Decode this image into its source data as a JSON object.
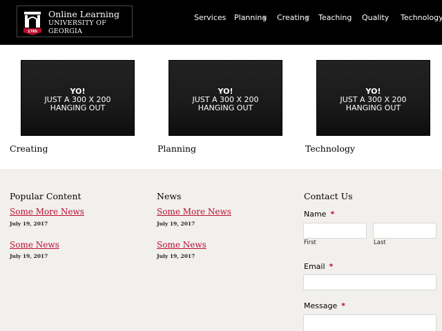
{
  "header": {
    "brand_title": "Online Learning",
    "brand_subtitle": "UNIVERSITY OF GEORGIA",
    "seal_year": "1785",
    "nav": [
      {
        "label": "Services",
        "has_dropdown": false
      },
      {
        "label": "Planning",
        "has_dropdown": true
      },
      {
        "label": "Creating",
        "has_dropdown": true
      },
      {
        "label": "Teaching",
        "has_dropdown": false
      },
      {
        "label": "Quality",
        "has_dropdown": false
      },
      {
        "label": "Technology",
        "has_dropdown": false
      }
    ],
    "dropdown_glyph": "▼"
  },
  "cards": [
    {
      "image_line1": "YO!",
      "image_line2": "JUST A 300 X 200",
      "image_line3": "HANGING OUT",
      "label": "Creating"
    },
    {
      "image_line1": "YO!",
      "image_line2": "JUST A 300 X 200",
      "image_line3": "HANGING OUT",
      "label": "Planning"
    },
    {
      "image_line1": "YO!",
      "image_line2": "JUST A 300 X 200",
      "image_line3": "HANGING OUT",
      "label": "Technology"
    }
  ],
  "popular": {
    "heading": "Popular Content",
    "items": [
      {
        "title": "Some More News",
        "date": "July 19, 2017"
      },
      {
        "title": "Some News",
        "date": "July 19, 2017"
      }
    ]
  },
  "news": {
    "heading": "News",
    "items": [
      {
        "title": "Some More News",
        "date": "July 19, 2017"
      },
      {
        "title": "Some News",
        "date": "July 19, 2017"
      }
    ]
  },
  "contact": {
    "heading": "Contact Us",
    "name_label": "Name",
    "required_mark": "*",
    "first_label": "First",
    "last_label": "Last",
    "email_label": "Email",
    "message_label": "Message",
    "first_value": "",
    "last_value": "",
    "email_value": "",
    "message_value": ""
  },
  "colors": {
    "header_bg": "#000000",
    "accent_red": "#ba0c2f",
    "footer_bg": "#f2f0ed"
  }
}
